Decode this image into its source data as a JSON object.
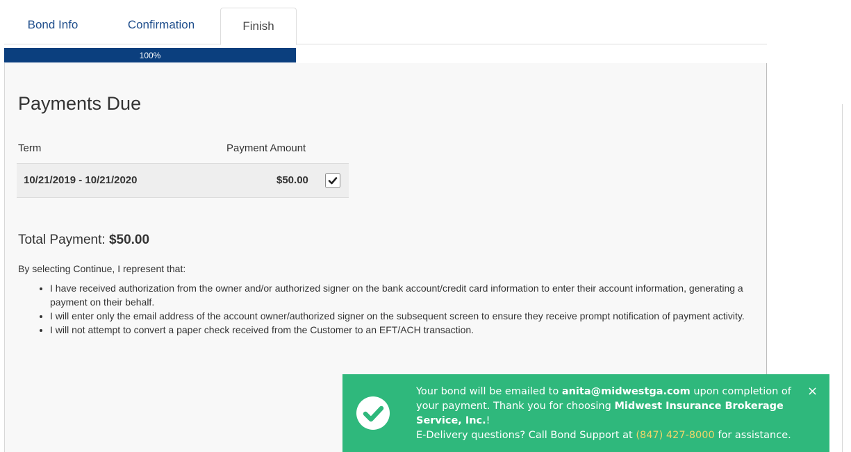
{
  "tabs": [
    {
      "label": "Bond Info"
    },
    {
      "label": "Confirmation"
    },
    {
      "label": "Finish"
    }
  ],
  "progress": {
    "percent": 100,
    "label": "100%"
  },
  "payments": {
    "title": "Payments Due",
    "columns": {
      "term": "Term",
      "amount": "Payment Amount"
    },
    "rows": [
      {
        "term": "10/21/2019 - 10/21/2020",
        "amount": "$50.00",
        "selected": true
      }
    ],
    "total_label": "Total Payment: ",
    "total_value": "$50.00"
  },
  "disclaimer": {
    "intro": "By selecting Continue, I represent that:",
    "items": [
      "I have received authorization from the owner and/or authorized signer on the bank account/credit card information to enter their account information, generating a payment on their behalf.",
      "I will enter only the email address of the account owner/authorized signer on the subsequent screen to ensure they receive prompt notification of payment activity.",
      "I will not attempt to convert a paper check received from the Customer to an EFT/ACH transaction."
    ]
  },
  "toast": {
    "text_1": "Your bond will be emailed to ",
    "email": "anita@midwestga.com",
    "text_2": " upon completion of your payment. Thank you for choosing ",
    "company": "Midwest Insurance Brokerage Service, Inc.",
    "text_3": "!",
    "text_4": "E-Delivery questions? Call Bond Support at ",
    "phone": "(847) 427-8000",
    "text_5": " for assistance.",
    "close": "×",
    "icon": "check-circle-icon",
    "bg_color": "#2fb87c"
  },
  "colors": {
    "accent": "#0b3f7e",
    "tab_link": "#1f4e8c"
  }
}
